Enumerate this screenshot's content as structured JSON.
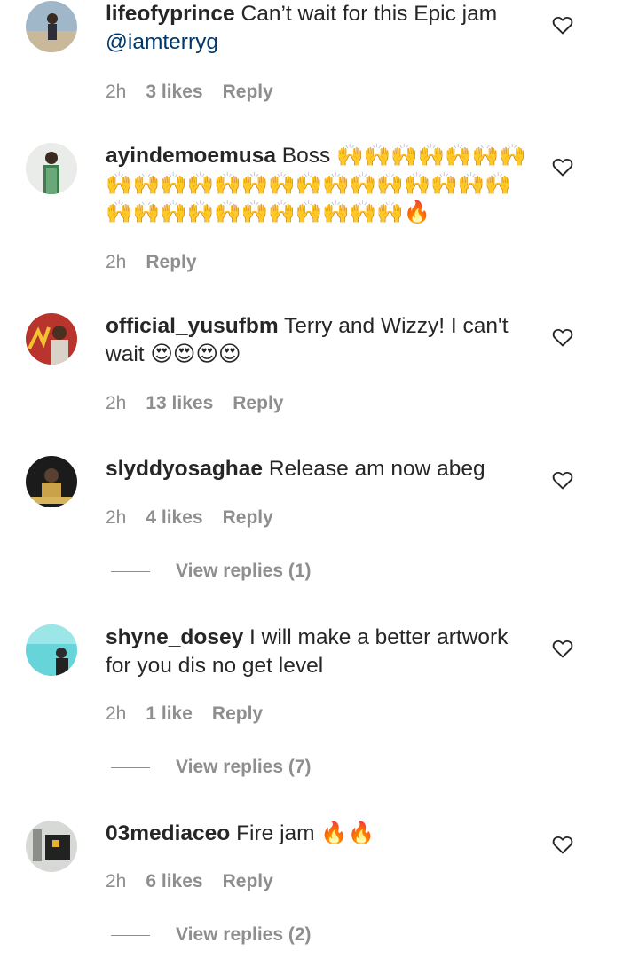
{
  "comments": [
    {
      "username": "lifeofyprince",
      "text": " Can’t wait for this Epic jam ",
      "mention": "@iamterryg",
      "time": "2h",
      "likes": "3 likes",
      "reply": "Reply",
      "view_replies": ""
    },
    {
      "username": "ayindemoemusa",
      "text": " Boss 🙌🙌🙌🙌🙌🙌🙌🙌🙌🙌🙌🙌🙌🙌🙌🙌🙌🙌🙌🙌🙌🙌🙌🙌🙌🙌🙌🙌🙌🙌🙌🙌🙌🔥",
      "mention": "",
      "time": "2h",
      "likes": "",
      "reply": "Reply",
      "view_replies": ""
    },
    {
      "username": "official_yusufbm",
      "text": " Terry and Wizzy! I can't wait 😍😍😍😍",
      "mention": "",
      "time": "2h",
      "likes": "13 likes",
      "reply": "Reply",
      "view_replies": ""
    },
    {
      "username": "slyddyosaghae",
      "text": " Release am now abeg",
      "mention": "",
      "time": "2h",
      "likes": "4 likes",
      "reply": "Reply",
      "view_replies": "View replies (1)"
    },
    {
      "username": "shyne_dosey",
      "text": " I will make a better artwork for you dis no get level",
      "mention": "",
      "time": "2h",
      "likes": "1 like",
      "reply": "Reply",
      "view_replies": "View replies (7)"
    },
    {
      "username": "03mediaceo",
      "text": " Fire jam 🔥🔥",
      "mention": "",
      "time": "2h",
      "likes": "6 likes",
      "reply": "Reply",
      "view_replies": "View replies (2)"
    }
  ],
  "icons": {
    "like": "heart-outline-icon"
  },
  "colors": {
    "text": "#262626",
    "secondary": "#8e8e8e",
    "mention": "#00376b"
  }
}
